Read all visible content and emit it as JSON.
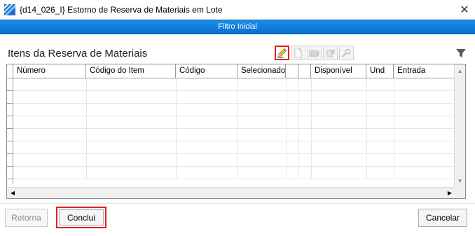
{
  "window": {
    "title": "{d14_026_I} Estorno de Reserva de Materiais em Lote",
    "close_glyph": "✕"
  },
  "filter_bar": {
    "label": "Filtro Inicial"
  },
  "panel": {
    "title": "Itens da Reserva de Materiais"
  },
  "toolbar": {
    "buttons": [
      {
        "icon": "edit-pen-icon",
        "state": "active"
      },
      {
        "icon": "new-document-icon",
        "state": "disabled"
      },
      {
        "icon": "open-folder-icon",
        "state": "disabled"
      },
      {
        "icon": "delete-icon",
        "state": "disabled"
      },
      {
        "icon": "search-key-icon",
        "state": "disabled"
      }
    ]
  },
  "grid": {
    "columns": [
      "Número",
      "Código do Item",
      "Código",
      "Selecionado",
      "",
      "",
      "Disponível",
      "Und",
      "Entrada"
    ],
    "rows": []
  },
  "buttons": {
    "retorna": "Retorna",
    "conclui": "Conclui",
    "cancelar": "Cancelar"
  },
  "colors": {
    "filter_bar": "#0a6fd2",
    "highlight": "#e02020"
  }
}
